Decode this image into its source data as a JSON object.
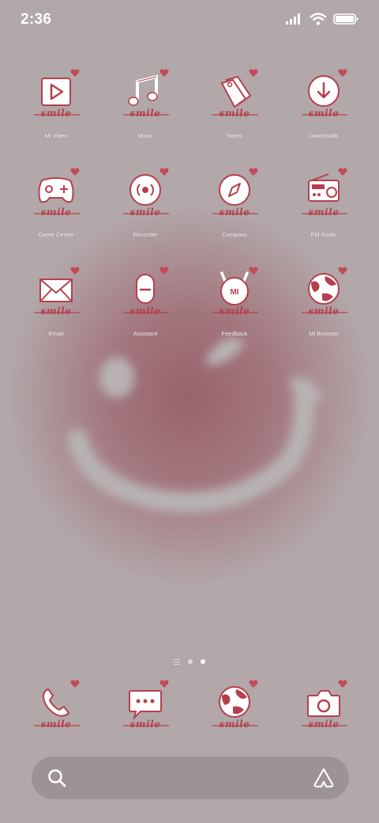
{
  "status_bar": {
    "time": "2:36",
    "icons": [
      "signal-icon",
      "wifi-icon",
      "battery-icon"
    ]
  },
  "theme": {
    "accent": "#b5404d",
    "heart": "#c24b5a",
    "icon_fill": "#ffffff",
    "badge_word": "smile"
  },
  "apps": [
    {
      "label": "Mi Video",
      "icon": "play-icon"
    },
    {
      "label": "Music",
      "icon": "music-note-icon"
    },
    {
      "label": "Notes",
      "icon": "tag-icon"
    },
    {
      "label": "Downloads",
      "icon": "download-icon"
    },
    {
      "label": "Game Center",
      "icon": "gamepad-icon"
    },
    {
      "label": "Recorder",
      "icon": "record-icon"
    },
    {
      "label": "Compass",
      "icon": "compass-icon"
    },
    {
      "label": "FM Radio",
      "icon": "radio-icon"
    },
    {
      "label": "Email",
      "icon": "envelope-icon"
    },
    {
      "label": "Assistant",
      "icon": "microphone-icon"
    },
    {
      "label": "Feedback",
      "icon": "mi-bunny-icon"
    },
    {
      "label": "Mi Browser",
      "icon": "globe-icon"
    }
  ],
  "dock": [
    {
      "label": "Phone",
      "icon": "phone-icon"
    },
    {
      "label": "Messages",
      "icon": "chat-icon"
    },
    {
      "label": "Browser",
      "icon": "globe-icon"
    },
    {
      "label": "Camera",
      "icon": "camera-icon"
    }
  ],
  "pages": {
    "count": 2,
    "current": 2
  },
  "search": {
    "left_icon": "search-icon",
    "right_icon": "app-vault-icon"
  }
}
